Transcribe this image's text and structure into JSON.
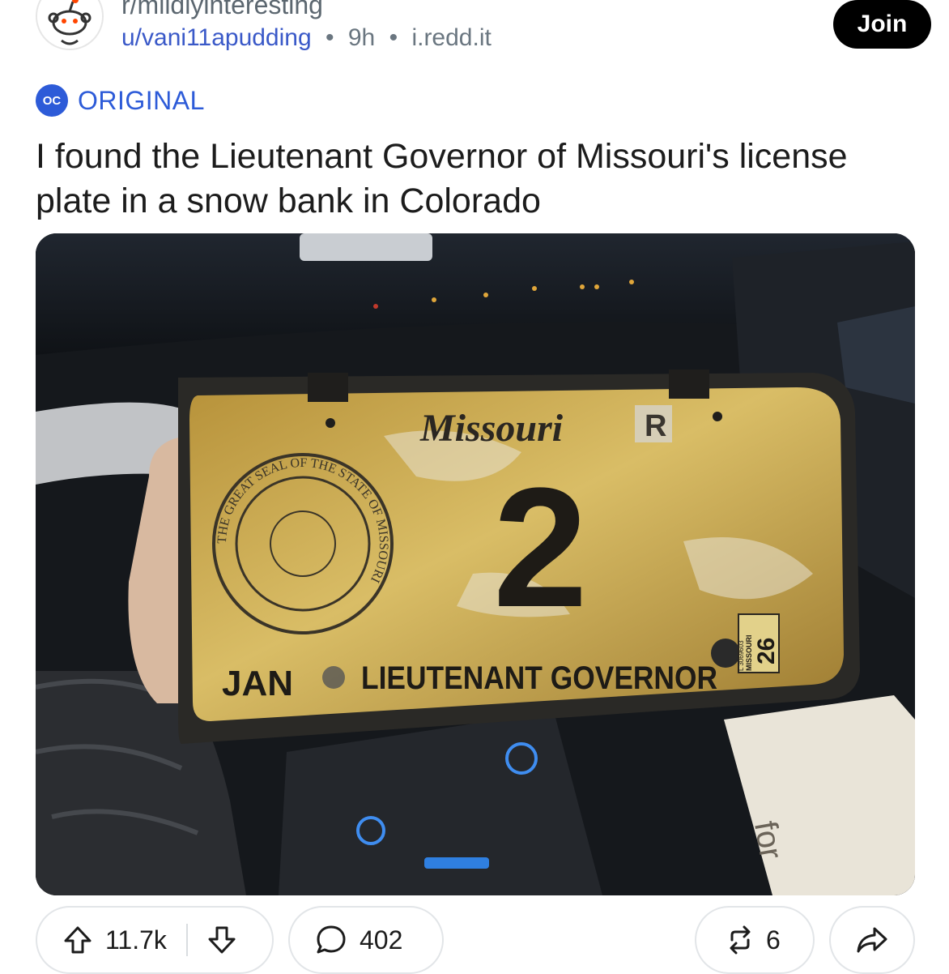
{
  "post": {
    "subreddit": "r/mildlyinteresting",
    "author": "u/vani11apudding",
    "age": "9h",
    "domain": "i.redd.it",
    "join_label": "Join",
    "flair": {
      "badge": "OC",
      "label": "ORIGINAL",
      "color": "#2d5bd8"
    },
    "title": "I found the Lieutenant Governor of Missouri's license plate in a snow bank in Colorado"
  },
  "image": {
    "plate": {
      "state": "Missouri",
      "number": "2",
      "month": "JAN",
      "caption": "LIEUTENANT GOVERNOR",
      "letter": "R",
      "seal_text": "THE GREAT SEAL OF THE STATE OF MISSOURI",
      "sticker_year": "26",
      "sticker_state": "MISSOURI",
      "sticker_serial": "L 3069603"
    },
    "bag_text": "for"
  },
  "actions": {
    "upvotes": "11.7k",
    "comments": "402",
    "shares": "6",
    "icons": {
      "upvote": "upvote-arrow-icon",
      "downvote": "downvote-arrow-icon",
      "comment": "comment-bubble-icon",
      "crosspost": "crosspost-icon",
      "share": "share-icon"
    }
  },
  "colors": {
    "accent": "#2d5bd8",
    "link": "#3a59c8",
    "join_bg": "#000000",
    "plate_gold": "#c9a84a"
  }
}
